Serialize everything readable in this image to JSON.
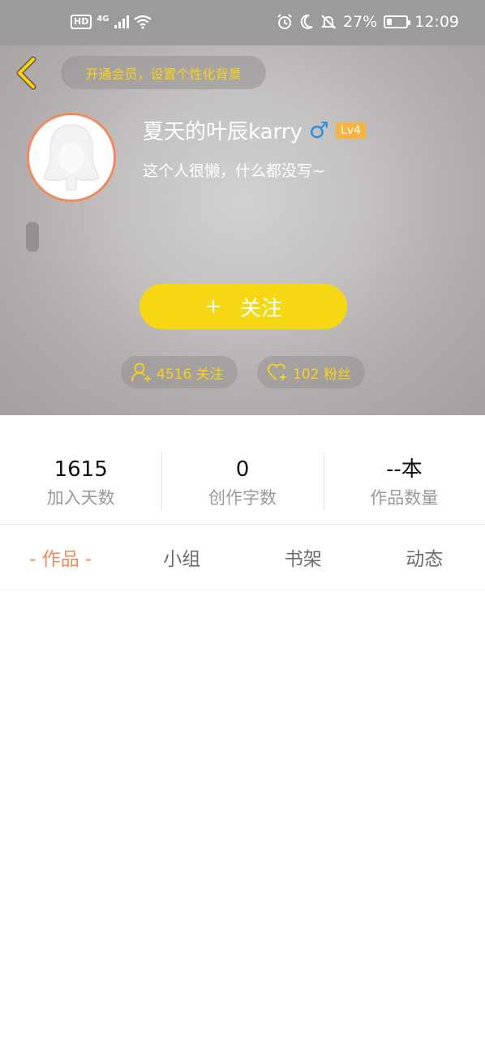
{
  "status_bar": {
    "network": "4G",
    "battery_percent": "27%",
    "battery_level": 0.27,
    "time": "12:09"
  },
  "header": {
    "vip_banner": "开通会员，设置个性化背景",
    "username": "夏天的叶辰karry",
    "gender_symbol": "♂",
    "level": "Lv4",
    "bio": "这个人很懒，什么都没写~",
    "follow_label": "关注",
    "follow_plus": "+",
    "following_text": "4516 关注",
    "fans_text": "102 粉丝"
  },
  "stats": [
    {
      "value": "1615",
      "label": "加入天数"
    },
    {
      "value": "0",
      "label": "创作字数"
    },
    {
      "value": "--本",
      "label": "作品数量"
    }
  ],
  "tabs": [
    {
      "label": "- 作品 -",
      "active": true
    },
    {
      "label": "小组",
      "active": false
    },
    {
      "label": "书架",
      "active": false
    },
    {
      "label": "动态",
      "active": false
    }
  ],
  "colors": {
    "accent_yellow": "#f6d713",
    "accent_orange": "#f08a5d",
    "gender_blue": "#2f8fd8",
    "level_badge": "#f6b43c"
  },
  "icons": {
    "back": "chevron-left-icon",
    "gender": "male-icon",
    "following": "user-plus-icon",
    "fans": "heart-plus-icon"
  }
}
